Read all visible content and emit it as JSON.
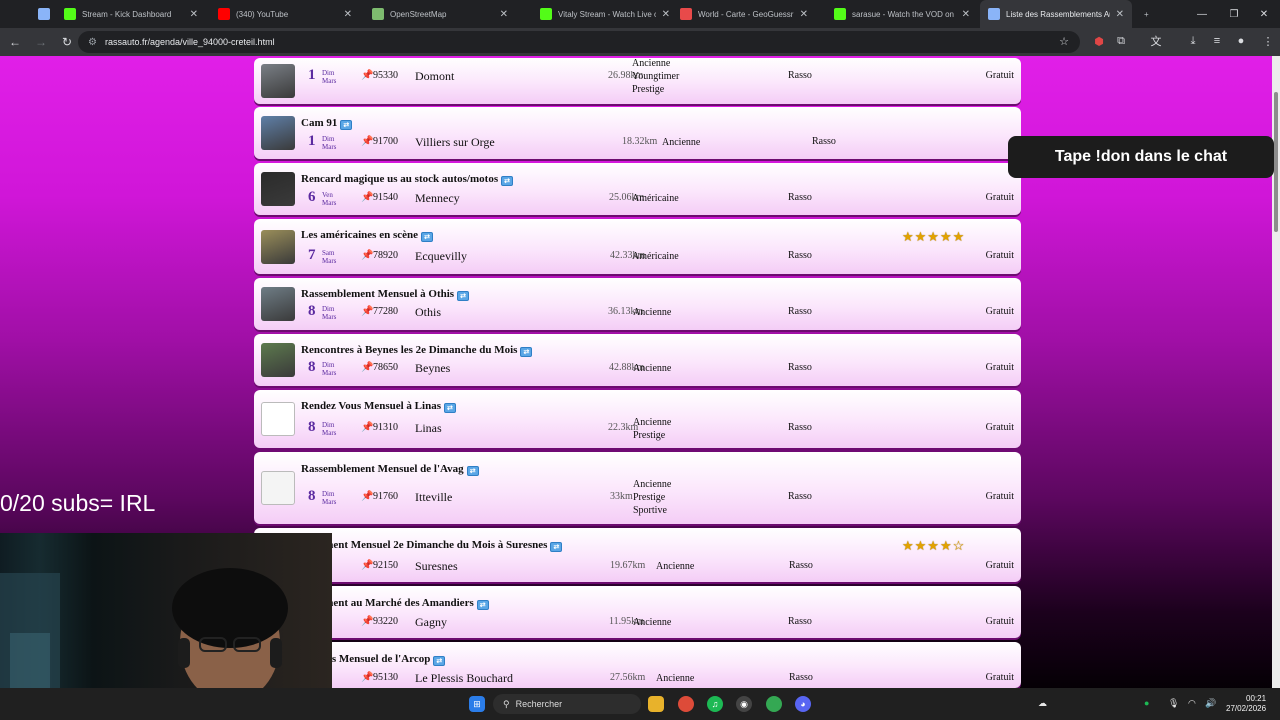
{
  "browser": {
    "tabs": [
      {
        "label": "",
        "icon": "doc-icon",
        "color": "#8ab4f8"
      },
      {
        "label": "Stream - Kick Dashboard",
        "icon": "kick-icon",
        "color": "#53fc18"
      },
      {
        "label": "(340) YouTube",
        "icon": "youtube-icon",
        "color": "#ff0000"
      },
      {
        "label": "OpenStreetMap",
        "icon": "osm-icon",
        "color": "#7ebc6f"
      },
      {
        "label": "Vitaly Stream - Watch Live on",
        "icon": "kick-icon",
        "color": "#53fc18"
      },
      {
        "label": "World - Carte - GeoGuessr",
        "icon": "geoguessr-icon",
        "color": "#e84a4a"
      },
      {
        "label": "sarasue - Watch the VOD on K",
        "icon": "kick-icon",
        "color": "#53fc18"
      },
      {
        "label": "Liste des Rassemblements Au",
        "icon": "list-icon",
        "color": "#8ab4f8"
      }
    ],
    "new_tab": "+",
    "url": "rassauto.fr/agenda/ville_94000-creteil.html"
  },
  "events": [
    {
      "name": "",
      "day": "1",
      "dow": "Dim",
      "month": "Mars",
      "cp": "95330",
      "city": "Domont",
      "dist": "26.98km",
      "kind": "Rasso",
      "cats": [
        "Ancienne",
        "Youngtimer",
        "Prestige"
      ],
      "price": "Gratuit",
      "stars": ""
    },
    {
      "name": "Cam 91",
      "day": "1",
      "dow": "Dim",
      "month": "Mars",
      "cp": "91700",
      "city": "Villiers sur Orge",
      "dist": "18.32km",
      "kind": "Rasso",
      "cats": [
        "Ancienne"
      ],
      "price": "",
      "stars": ""
    },
    {
      "name": "Rencard magique us au stock autos/motos",
      "day": "6",
      "dow": "Ven",
      "month": "Mars",
      "cp": "91540",
      "city": "Mennecy",
      "dist": "25.06km",
      "kind": "Rasso",
      "cats": [
        "Américaine"
      ],
      "price": "Gratuit",
      "stars": ""
    },
    {
      "name": "Les américaines en scène",
      "day": "7",
      "dow": "Sam",
      "month": "Mars",
      "cp": "78920",
      "city": "Ecquevilly",
      "dist": "42.33km",
      "kind": "Rasso",
      "cats": [
        "Américaine"
      ],
      "price": "Gratuit",
      "stars": "★★★★★"
    },
    {
      "name": "Rassemblement Mensuel à Othis",
      "day": "8",
      "dow": "Dim",
      "month": "Mars",
      "cp": "77280",
      "city": "Othis",
      "dist": "36.13km",
      "kind": "Rasso",
      "cats": [
        "Ancienne"
      ],
      "price": "Gratuit",
      "stars": ""
    },
    {
      "name": "Rencontres à Beynes les 2e Dimanche du Mois",
      "day": "8",
      "dow": "Dim",
      "month": "Mars",
      "cp": "78650",
      "city": "Beynes",
      "dist": "42.88km",
      "kind": "Rasso",
      "cats": [
        "Ancienne"
      ],
      "price": "Gratuit",
      "stars": ""
    },
    {
      "name": "Rendez Vous Mensuel à Linas",
      "day": "8",
      "dow": "Dim",
      "month": "Mars",
      "cp": "91310",
      "city": "Linas",
      "dist": "22.3km",
      "kind": "Rasso",
      "cats": [
        "Ancienne",
        "Prestige"
      ],
      "price": "Gratuit",
      "stars": ""
    },
    {
      "name": "Rassemblement Mensuel de l'Avag",
      "day": "8",
      "dow": "Dim",
      "month": "Mars",
      "cp": "91760",
      "city": "Itteville",
      "dist": "33km",
      "kind": "Rasso",
      "cats": [
        "Ancienne",
        "Prestige",
        "Sportive"
      ],
      "price": "Gratuit",
      "stars": ""
    },
    {
      "name": "mblement Mensuel 2e Dimanche du Mois à Suresnes",
      "day": "",
      "dow": "",
      "month": "",
      "cp": "92150",
      "city": "Suresnes",
      "dist": "19.67km",
      "kind": "Rasso",
      "cats": [
        "Ancienne"
      ],
      "price": "Gratuit",
      "stars": "★★★★☆"
    },
    {
      "name": "mblement au Marché des Amandiers",
      "day": "",
      "dow": "",
      "month": "",
      "cp": "93220",
      "city": "Gagny",
      "dist": "11.95km",
      "kind": "Rasso",
      "cats": [
        "Ancienne"
      ],
      "price": "Gratuit",
      "stars": ""
    },
    {
      "name": "ez Vous Mensuel de l'Arcop",
      "day": "",
      "dow": "",
      "month": "",
      "cp": "95130",
      "city": "Le Plessis Bouchard",
      "dist": "27.56km",
      "kind": "Rasso",
      "cats": [
        "Ancienne"
      ],
      "price": "Gratuit",
      "stars": ""
    }
  ],
  "overlay": {
    "don": "Tape !don dans le chat",
    "subs": "0/20 subs= IRL"
  },
  "taskbar": {
    "search": "Rechercher",
    "time": "00:21",
    "date": "27/02/2026"
  }
}
